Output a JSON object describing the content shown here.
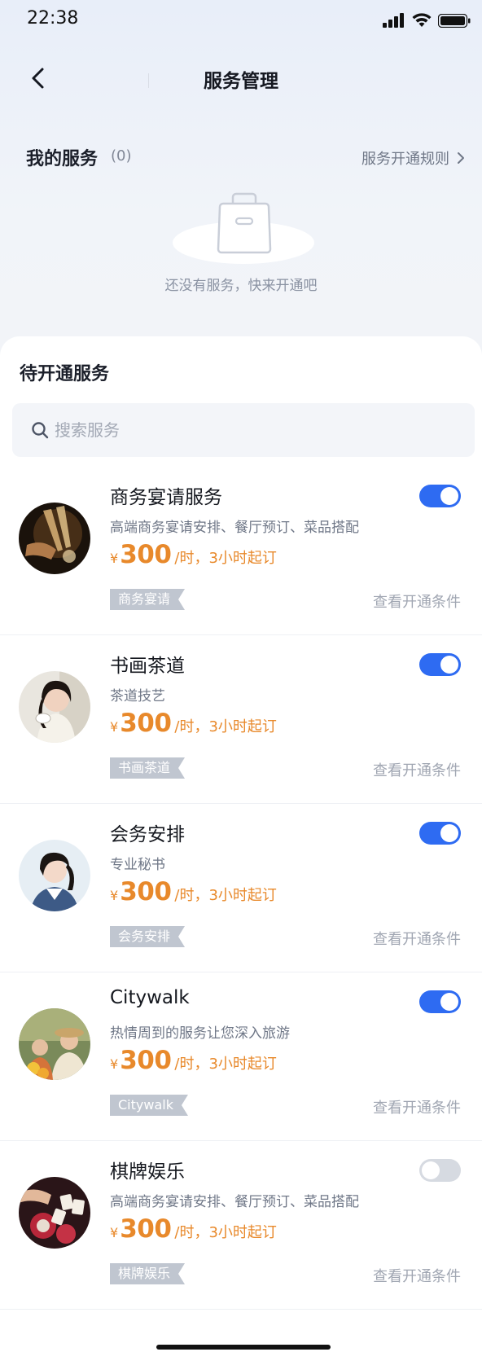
{
  "status_bar": {
    "time": "22:38"
  },
  "nav": {
    "title": "服务管理"
  },
  "my_services": {
    "title": "我的服务",
    "count": "(0)",
    "rules_link": "服务开通规则",
    "empty_text": "还没有服务，快来开通吧"
  },
  "pending": {
    "title": "待开通服务",
    "search_placeholder": "搜索服务"
  },
  "services": [
    {
      "name": "商务宴请服务",
      "desc": "高端商务宴请安排、餐厅预订、菜品搭配",
      "price_symbol": "¥",
      "price": "300",
      "unit": "/时，3小时起订",
      "tag": "商务宴请",
      "link": "查看开通条件",
      "enabled": true
    },
    {
      "name": "书画茶道",
      "desc": "茶道技艺",
      "price_symbol": "¥",
      "price": "300",
      "unit": "/时，3小时起订",
      "tag": "书画茶道",
      "link": "查看开通条件",
      "enabled": true
    },
    {
      "name": "会务安排",
      "desc": "专业秘书",
      "price_symbol": "¥",
      "price": "300",
      "unit": "/时，3小时起订",
      "tag": "会务安排",
      "link": "查看开通条件",
      "enabled": true
    },
    {
      "name": "Citywalk",
      "desc": "热情周到的服务让您深入旅游",
      "price_symbol": "¥",
      "price": "300",
      "unit": "/时，3小时起订",
      "tag": "Citywalk",
      "link": "查看开通条件",
      "enabled": true
    },
    {
      "name": "棋牌娱乐",
      "desc": "高端商务宴请安排、餐厅预订、菜品搭配",
      "price_symbol": "¥",
      "price": "300",
      "unit": "/时，3小时起订",
      "tag": "棋牌娱乐",
      "link": "查看开通条件",
      "enabled": false
    }
  ],
  "colors": {
    "accent": "#2e6bf2",
    "price": "#e8892b",
    "tag_bg": "#c0c6d0"
  }
}
